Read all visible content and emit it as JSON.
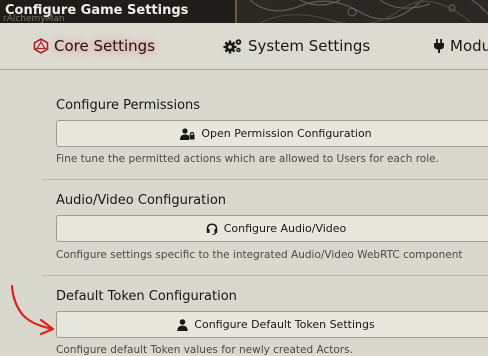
{
  "window": {
    "title": "Configure Game Settings",
    "ghost_text": "rAlchemyMan"
  },
  "tabs": [
    {
      "label": "Core Settings",
      "icon": "d20-icon",
      "active": true
    },
    {
      "label": "System Settings",
      "icon": "gears-icon",
      "active": false
    },
    {
      "label": "Modu",
      "icon": "plug-icon",
      "active": false
    }
  ],
  "sections": [
    {
      "heading": "Configure Permissions",
      "button_label": "Open Permission Configuration",
      "button_icon": "user-lock-icon",
      "hint": "Fine tune the permitted actions which are allowed to Users for each role."
    },
    {
      "heading": "Audio/Video Configuration",
      "button_label": "Configure Audio/Video",
      "button_icon": "headset-icon",
      "hint": "Configure settings specific to the integrated Audio/Video WebRTC component"
    },
    {
      "heading": "Default Token Configuration",
      "button_label": "Configure Default Token Settings",
      "button_icon": "user-icon",
      "hint": "Configure default Token values for newly created Actors."
    }
  ],
  "annotation": {
    "icon": "red-arrow-icon",
    "color": "#e0201a"
  },
  "colors": {
    "active_tab_glow": "#ff6a6a",
    "annotation_red": "#e0201a"
  }
}
